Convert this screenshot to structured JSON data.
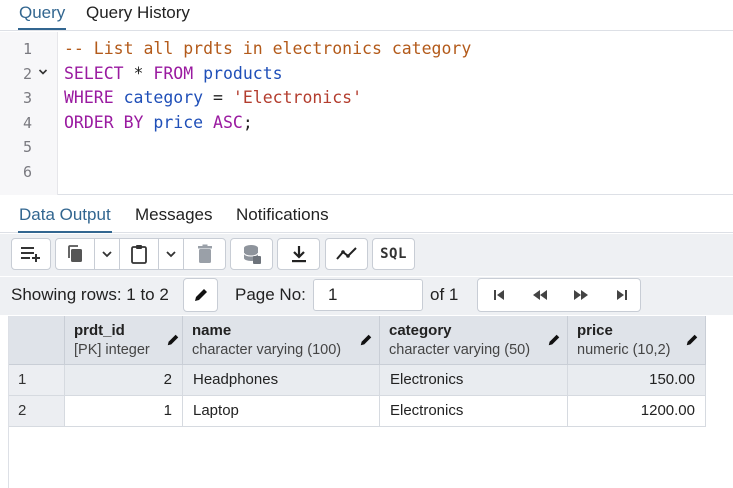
{
  "tabs": {
    "query": "Query",
    "history": "Query History"
  },
  "editor": {
    "line_numbers": [
      "1",
      "2",
      "3",
      "4",
      "5",
      "6"
    ],
    "comment": "-- List all prdts in electronics category",
    "kw_select": "SELECT",
    "star": " * ",
    "kw_from": "FROM",
    "table": "products",
    "kw_where": "WHERE",
    "col_category": "category",
    "eq": " = ",
    "str_value": "'Electronics'",
    "kw_order_by": "ORDER BY",
    "col_price": "price",
    "kw_asc": "ASC",
    "semicolon": ";"
  },
  "output_tabs": {
    "data": "Data Output",
    "messages": "Messages",
    "notifications": "Notifications"
  },
  "toolbar": {
    "sql_label": "SQL",
    "icons": [
      "add-row-icon",
      "copy-icon",
      "chevron-down-icon",
      "paste-icon",
      "chevron-down-icon",
      "delete-icon",
      "save-data-icon",
      "download-icon",
      "graph-icon",
      "sql-icon"
    ]
  },
  "pager": {
    "showing_rows": "Showing rows: 1 to 2",
    "page_no_label": "Page No:",
    "page_value": "1",
    "of_label": "of 1"
  },
  "grid": {
    "columns": [
      {
        "name": "prdt_id",
        "type": "[PK] integer"
      },
      {
        "name": "name",
        "type": "character varying (100)"
      },
      {
        "name": "category",
        "type": "character varying (50)"
      },
      {
        "name": "price",
        "type": "numeric (10,2)"
      }
    ],
    "rows": [
      {
        "num": "1",
        "prdt_id": "2",
        "name": "Headphones",
        "category": "Electronics",
        "price": "150.00"
      },
      {
        "num": "2",
        "prdt_id": "1",
        "name": "Laptop",
        "category": "Electronics",
        "price": "1200.00"
      }
    ]
  },
  "colors": {
    "accent": "#326690",
    "keyword": "#9a1aa0",
    "comment": "#b35a1a",
    "identifier": "#1f4fb8",
    "string": "#b33d2e"
  }
}
